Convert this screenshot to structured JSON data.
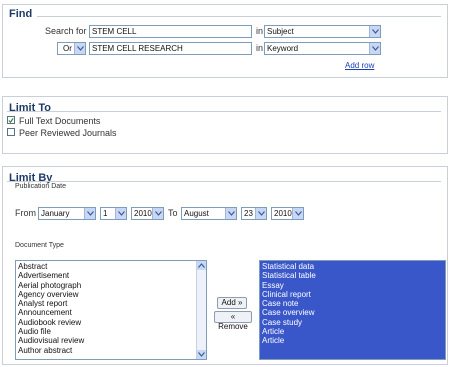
{
  "find": {
    "title": "Find",
    "search_for_label": "Search for",
    "row1": {
      "term": "STEM CELL",
      "in_label": "in",
      "field": "Subject"
    },
    "row2": {
      "operator": "Or",
      "term": "STEM CELL RESEARCH",
      "in_label": "in",
      "field": "Keyword"
    },
    "add_row": "Add row"
  },
  "limit_to": {
    "title": "Limit To",
    "options": [
      {
        "label": "Full Text Documents",
        "checked": true
      },
      {
        "label": "Peer Reviewed Journals",
        "checked": false
      }
    ]
  },
  "limit_by": {
    "title": "Limit By",
    "publication_date_label": "Publication Date",
    "from_label": "From",
    "from_month": "January",
    "from_day": "1",
    "from_year": "2010",
    "to_label": "To",
    "to_month": "August",
    "to_day": "23",
    "to_year": "2010",
    "document_type_label": "Document Type",
    "available_types": [
      "Abstract",
      "Advertisement",
      "Aerial photograph",
      "Agency overview",
      "Analyst report",
      "Announcement",
      "Audiobook review",
      "Audio file",
      "Audiovisual review",
      "Author abstract"
    ],
    "add_label": "Add »",
    "remove_label": "« Remove",
    "selected_types": [
      "Statistical data",
      "Statistical table",
      "Essay",
      "Clinical report",
      "Case note",
      "Case overview",
      "Case study",
      "Article",
      "Article"
    ]
  }
}
